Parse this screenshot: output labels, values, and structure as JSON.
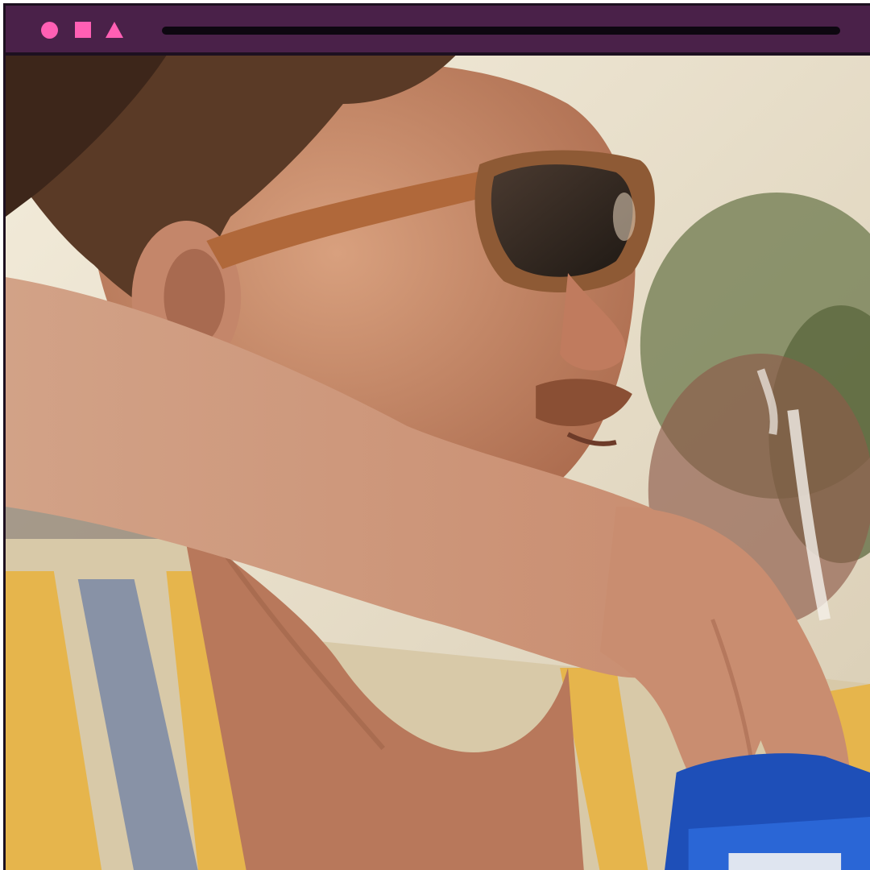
{
  "window": {
    "controls": [
      {
        "name": "circle-icon",
        "color": "#ff5fb4"
      },
      {
        "name": "square-icon",
        "color": "#ff5fb4"
      },
      {
        "name": "triangle-icon",
        "color": "#ff5fb4"
      }
    ],
    "titlebar_color": "#4a2149",
    "address_bar_color": "#0d0710",
    "frame_border_color": "#1d1020"
  },
  "content": {
    "image_subject": "photo-man-sunglasses-beer-can"
  }
}
